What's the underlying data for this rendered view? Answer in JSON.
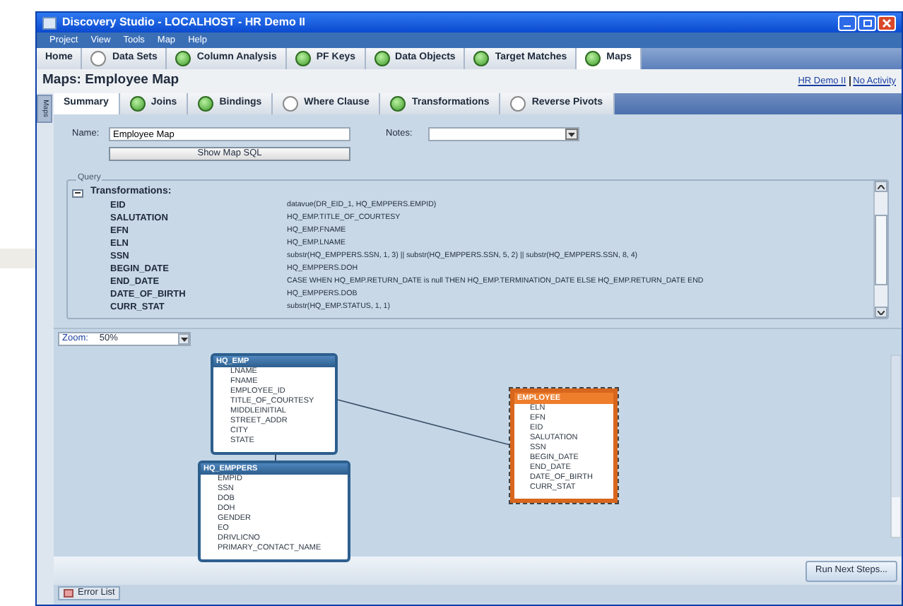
{
  "window": {
    "title": "Discovery Studio - LOCALHOST - HR Demo II"
  },
  "menu": [
    "Project",
    "View",
    "Tools",
    "Map",
    "Help"
  ],
  "tabs": [
    {
      "label": "Home",
      "kind": "plain",
      "selected": false
    },
    {
      "label": "Data Sets",
      "kind": "pending",
      "selected": false
    },
    {
      "label": "Column Analysis",
      "kind": "done",
      "selected": false
    },
    {
      "label": "PF Keys",
      "kind": "done",
      "selected": false
    },
    {
      "label": "Data Objects",
      "kind": "done",
      "selected": false
    },
    {
      "label": "Target Matches",
      "kind": "done",
      "selected": false
    },
    {
      "label": "Maps",
      "kind": "done",
      "selected": true
    }
  ],
  "header": {
    "title": "Maps: Employee Map",
    "links": [
      "HR Demo II",
      "No Activity"
    ]
  },
  "side_tab": "Maps",
  "subtabs": [
    {
      "label": "Summary",
      "kind": "plain",
      "selected": true
    },
    {
      "label": "Joins",
      "kind": "done",
      "selected": false
    },
    {
      "label": "Bindings",
      "kind": "done",
      "selected": false
    },
    {
      "label": "Where Clause",
      "kind": "pending",
      "selected": false
    },
    {
      "label": "Transformations",
      "kind": "done",
      "selected": false
    },
    {
      "label": "Reverse Pivots",
      "kind": "pending",
      "selected": false
    }
  ],
  "form": {
    "name_label": "Name:",
    "name_value": "Employee Map",
    "notes_label": "Notes:",
    "show_sql_button": "Show Map SQL"
  },
  "query": {
    "legend": "Query",
    "section": "Transformations:",
    "expanded": true,
    "rows": [
      {
        "name": "EID",
        "expr": "datavue(DR_EID_1, HQ_EMPPERS.EMPID)"
      },
      {
        "name": "SALUTATION",
        "expr": "HQ_EMP.TITLE_OF_COURTESY"
      },
      {
        "name": "EFN",
        "expr": "HQ_EMP.FNAME"
      },
      {
        "name": "ELN",
        "expr": "HQ_EMP.LNAME"
      },
      {
        "name": "SSN",
        "expr": "substr(HQ_EMPPERS.SSN, 1, 3) || substr(HQ_EMPPERS.SSN, 5, 2) || substr(HQ_EMPPERS.SSN, 8, 4)"
      },
      {
        "name": "BEGIN_DATE",
        "expr": "HQ_EMPPERS.DOH"
      },
      {
        "name": "END_DATE",
        "expr": "CASE WHEN HQ_EMP.RETURN_DATE is null THEN HQ_EMP.TERMINATION_DATE ELSE HQ_EMP.RETURN_DATE END"
      },
      {
        "name": "DATE_OF_BIRTH",
        "expr": "HQ_EMPPERS.DOB"
      },
      {
        "name": "CURR_STAT",
        "expr": "substr(HQ_EMP.STATUS, 1, 1)"
      }
    ]
  },
  "zoom": {
    "label": "Zoom:",
    "value": "50%"
  },
  "diagram": {
    "tables": [
      {
        "name": "HQ_EMP",
        "kind": "source",
        "selected": false,
        "fields": [
          "LNAME",
          "FNAME",
          "EMPLOYEE_ID",
          "TITLE_OF_COURTESY",
          "MIDDLEINITIAL",
          "STREET_ADDR",
          "CITY",
          "STATE"
        ]
      },
      {
        "name": "HQ_EMPPERS",
        "kind": "source",
        "selected": false,
        "fields": [
          "EMPID",
          "SSN",
          "DOB",
          "DOH",
          "GENDER",
          "EO",
          "DRIVLICNO",
          "PRIMARY_CONTACT_NAME"
        ]
      },
      {
        "name": "EMPLOYEE",
        "kind": "target",
        "selected": true,
        "fields": [
          "ELN",
          "EFN",
          "EID",
          "SALUTATION",
          "SSN",
          "BEGIN_DATE",
          "END_DATE",
          "DATE_OF_BIRTH",
          "CURR_STAT"
        ]
      }
    ]
  },
  "run_button": "Run Next Steps...",
  "bottom_tab": "Error List"
}
